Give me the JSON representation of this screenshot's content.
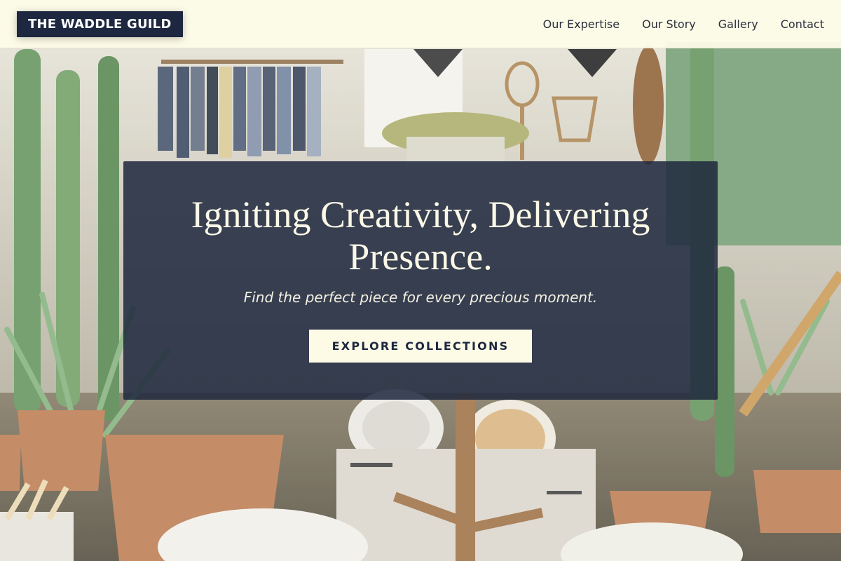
{
  "header": {
    "logo": "THE WADDLE GUILD",
    "nav": [
      {
        "label": "Our Expertise"
      },
      {
        "label": "Our Story"
      },
      {
        "label": "Gallery"
      },
      {
        "label": "Contact"
      }
    ]
  },
  "hero": {
    "title": "Igniting Creativity, Delivering Presence.",
    "subtitle": "Find the perfect piece for every precious moment.",
    "cta_label": "EXPLORE COLLECTIONS"
  },
  "colors": {
    "brand_navy": "#1d2740",
    "header_cream": "#fdfce8",
    "cta_cream": "#fdfbe6",
    "overlay": "#1e283e"
  }
}
